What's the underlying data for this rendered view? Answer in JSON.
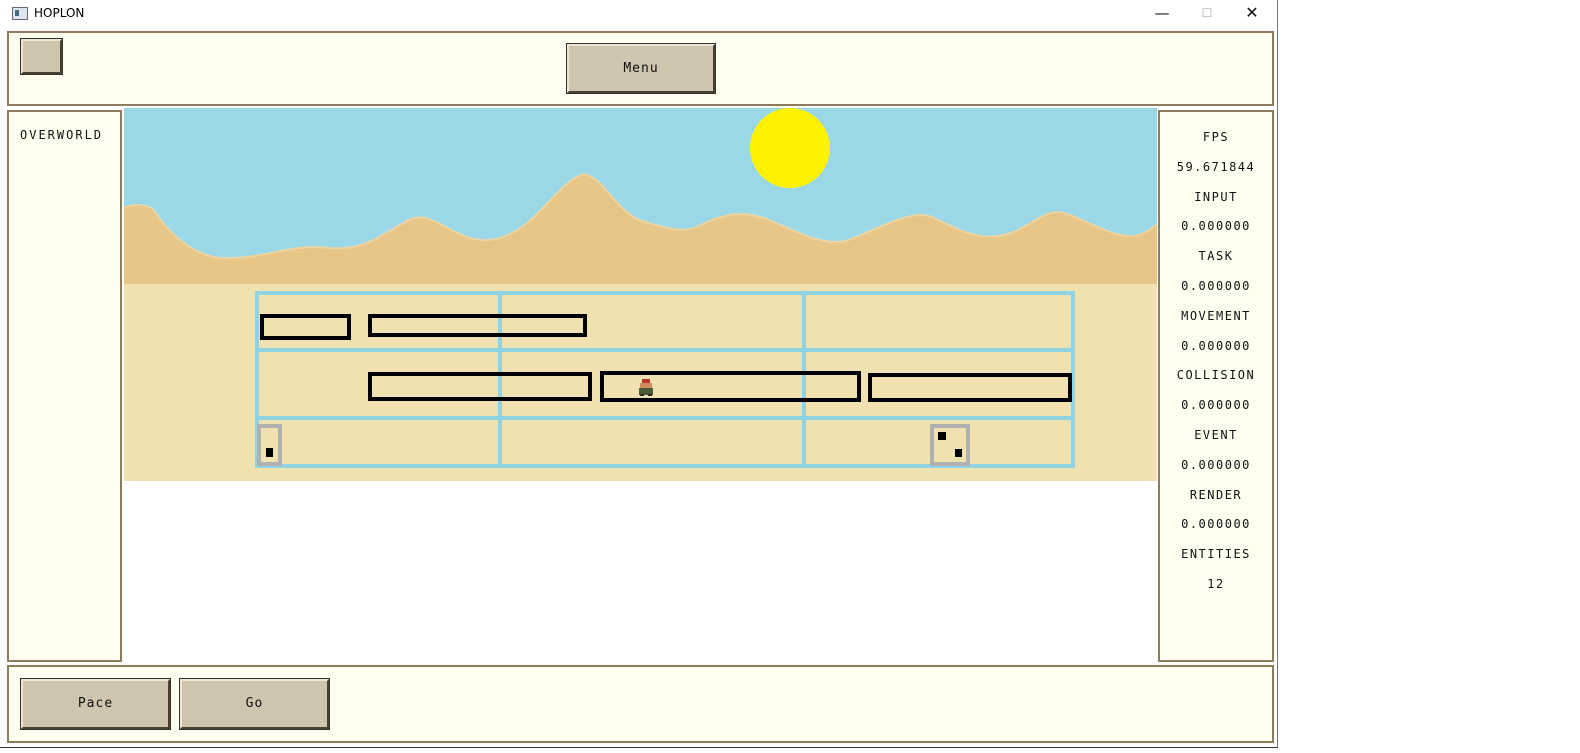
{
  "window": {
    "title": "HOPLON",
    "controls": {
      "minimize": "—",
      "maximize": "☐",
      "close": "✕"
    }
  },
  "toolbar": {
    "menu_label": "Menu"
  },
  "sidebar": {
    "mode_label": "OVERWORLD"
  },
  "stats": [
    {
      "label": "FPS",
      "value": "59.671844"
    },
    {
      "label": "INPUT",
      "value": "0.000000"
    },
    {
      "label": "TASK",
      "value": "0.000000"
    },
    {
      "label": "MOVEMENT",
      "value": "0.000000"
    },
    {
      "label": "COLLISION",
      "value": "0.000000"
    },
    {
      "label": "EVENT",
      "value": "0.000000"
    },
    {
      "label": "RENDER",
      "value": "0.000000"
    },
    {
      "label": "ENTITIES",
      "value": "12"
    }
  ],
  "actions": {
    "pace_label": "Pace",
    "go_label": "Go"
  },
  "scene": {
    "colors": {
      "sky": "#9ad8e8",
      "sun": "#fff200",
      "mountains": "#e6c587",
      "sand": "#efe2b0",
      "grid": "#8fd3e4",
      "wall_outline": "#000000",
      "crate_outline": "#b0b0b0"
    },
    "grid": {
      "rows": 3,
      "columns": 3
    },
    "player_icon": "hoplite-sprite"
  }
}
